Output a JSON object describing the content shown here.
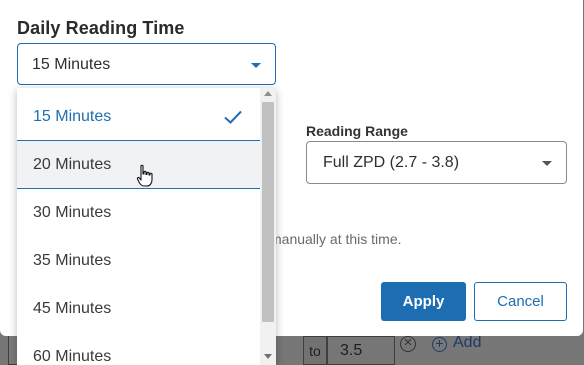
{
  "background": {
    "to_label": "to",
    "range_end_value": "3.5",
    "add_label": "Add"
  },
  "modal": {
    "title": "Daily Reading Time",
    "reading_time_select": {
      "selected": "15 Minutes",
      "options": [
        {
          "label": "15 Minutes",
          "selected": true
        },
        {
          "label": "20 Minutes",
          "hovered": true
        },
        {
          "label": "30 Minutes"
        },
        {
          "label": "35 Minutes"
        },
        {
          "label": "45 Minutes"
        },
        {
          "label": "60 Minutes"
        }
      ]
    },
    "reading_range": {
      "label": "Reading Range",
      "selected": "Full ZPD (2.7 - 3.8)"
    },
    "note_fragment": "manually at this time.",
    "apply_label": "Apply",
    "cancel_label": "Cancel"
  },
  "colors": {
    "accent": "#1f6fb2",
    "overlay": "#777777"
  },
  "icons": {
    "check": "checkmark-icon",
    "caret": "chevron-down-icon",
    "clear": "clear-circle-icon",
    "add": "add-circle-icon"
  }
}
